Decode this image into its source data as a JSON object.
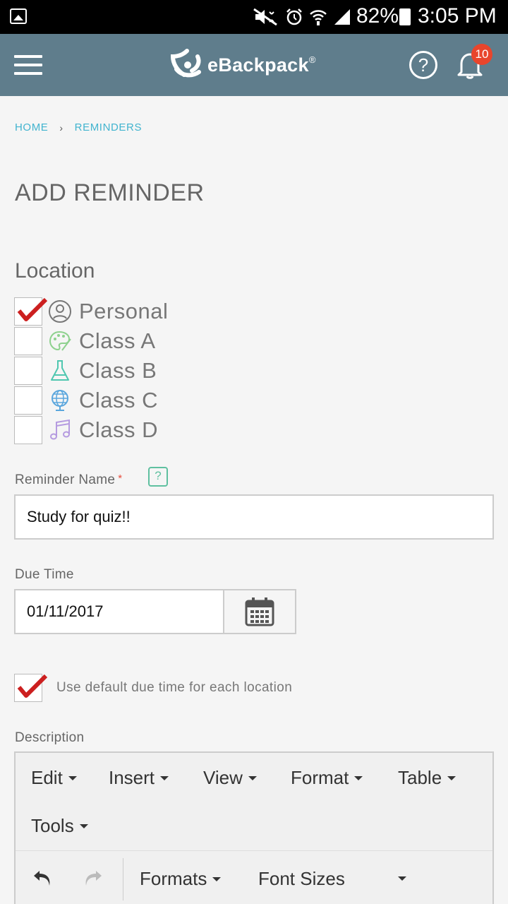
{
  "status_bar": {
    "battery_percent": "82%",
    "time": "3:05 PM",
    "icons": [
      "gallery-icon",
      "mute-icon",
      "alarm-icon",
      "wifi-icon",
      "signal-icon",
      "battery-icon"
    ]
  },
  "header": {
    "menu_icon": "hamburger-icon",
    "brand": "eBackpack",
    "brand_mark": "®",
    "help_label": "?",
    "notification_count": "10",
    "colors": {
      "bar": "#5f7d8c",
      "badge": "#e8452c"
    }
  },
  "breadcrumb": {
    "items": [
      "HOME",
      "REMINDERS"
    ],
    "separator": "›"
  },
  "page": {
    "title": "ADD REMINDER"
  },
  "location": {
    "label": "Location",
    "options": [
      {
        "label": "Personal",
        "icon": "person-icon",
        "checked": true,
        "icon_color": "#777777"
      },
      {
        "label": "Class A",
        "icon": "palette-icon",
        "checked": false,
        "icon_color": "#8ed18e"
      },
      {
        "label": "Class B",
        "icon": "flask-icon",
        "checked": false,
        "icon_color": "#4fc7b0"
      },
      {
        "label": "Class C",
        "icon": "globe-icon",
        "checked": false,
        "icon_color": "#5aa6dd"
      },
      {
        "label": "Class D",
        "icon": "music-note-icon",
        "checked": false,
        "icon_color": "#b59be0"
      }
    ]
  },
  "reminder_name": {
    "label": "Reminder Name",
    "required_mark": "*",
    "help": "?",
    "value": "Study for quiz!!"
  },
  "due_time": {
    "label": "Due Time",
    "value": "01/11/2017"
  },
  "default_due": {
    "checked": true,
    "label": "Use default due time for each location"
  },
  "description": {
    "label": "Description",
    "menu": [
      "Edit",
      "Insert",
      "View",
      "Format",
      "Table",
      "Tools"
    ],
    "toolbar": {
      "undo_icon": "undo-icon",
      "redo_icon": "redo-icon",
      "formats_label": "Formats",
      "font_sizes_label": "Font Sizes"
    }
  },
  "colors": {
    "accent_link": "#42b4cf",
    "check": "#cc1f1f",
    "required": "#e74c3c",
    "help_small": "#5fc0a0"
  }
}
